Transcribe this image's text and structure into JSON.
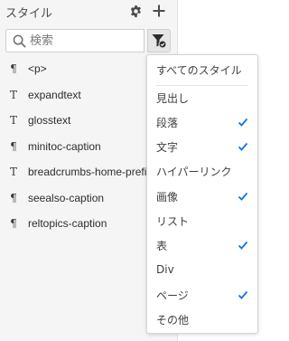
{
  "panel": {
    "title": "スタイル",
    "icons": {
      "settings": "gear-icon",
      "add": "plus-icon"
    }
  },
  "search": {
    "placeholder": "検索",
    "value": "",
    "icon": "search-icon",
    "filter_icon": "filter-funnel-icon"
  },
  "styles": [
    {
      "type_icon": "¶",
      "icon_name": "paragraph-style-icon",
      "name": "<p>"
    },
    {
      "type_icon": "T",
      "icon_name": "character-style-icon",
      "name": "expandtext"
    },
    {
      "type_icon": "T",
      "icon_name": "character-style-icon",
      "name": "glosstext"
    },
    {
      "type_icon": "¶",
      "icon_name": "paragraph-style-icon",
      "name": "minitoc-caption"
    },
    {
      "type_icon": "T",
      "icon_name": "character-style-icon",
      "name": "breadcrumbs-home-prefix"
    },
    {
      "type_icon": "¶",
      "icon_name": "paragraph-style-icon",
      "name": "seealso-caption"
    },
    {
      "type_icon": "¶",
      "icon_name": "paragraph-style-icon",
      "name": "reltopics-caption"
    }
  ],
  "filter_menu": {
    "all_label": "すべてのスタイル",
    "items": [
      {
        "label": "見出し",
        "checked": false
      },
      {
        "label": "段落",
        "checked": true
      },
      {
        "label": "文字",
        "checked": true
      },
      {
        "label": "ハイパーリンク",
        "checked": false
      },
      {
        "label": "画像",
        "checked": true
      },
      {
        "label": "リスト",
        "checked": false
      },
      {
        "label": "表",
        "checked": true
      },
      {
        "label": "Div",
        "checked": false
      },
      {
        "label": "ページ",
        "checked": true
      },
      {
        "label": "その他",
        "checked": false
      }
    ],
    "check_color": "#1473e6"
  },
  "colors": {
    "panel_bg": "#f5f5f5",
    "accent": "#1473e6"
  }
}
